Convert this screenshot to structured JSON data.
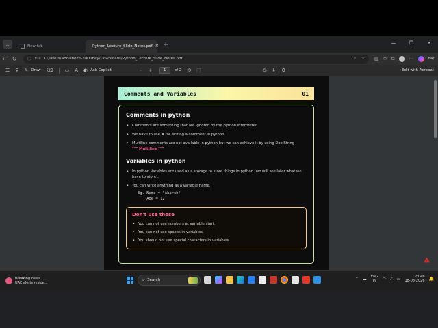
{
  "browser": {
    "tabs": [
      {
        "label": "New tab",
        "active": false
      },
      {
        "label": "Python_Lecture_Slide_Notes.pdf",
        "active": true
      }
    ],
    "address": {
      "scheme_label": "File",
      "url": "C:/Users/Abhishek%20Dubey/Downloads/Python_Lecture_Slide_Notes.pdf"
    },
    "chat_label": "Chat"
  },
  "pdf_toolbar": {
    "draw_label": "Draw",
    "ask_copilot_label": "Ask Copilot",
    "page_current": "1",
    "page_of": "of 2",
    "edit_acrobat_label": "Edit with Acrobat"
  },
  "slide": {
    "title": "Comments and Variables",
    "number": "01",
    "comments": {
      "heading": "Comments in python",
      "bullets": [
        "Comments are something that are ignored by the python interpreter.",
        "We have to use # for writing a comment in python."
      ],
      "multiline_text": "Multiline comments are not available in python but we can achieve it by using Doc String",
      "multiline_example": "\"\"\" Multiline \"\"\""
    },
    "variables": {
      "heading": "Variables in python",
      "bullets": [
        "In python Variables are used as a storage to store things in python (we will see later what we have to store).",
        "You can write anything as a variable name."
      ],
      "code_line1": "Eg. Name = \"Akarsh\"",
      "code_line2": "    Age = 12"
    },
    "dont_use": {
      "heading": "Don't use these",
      "bullets": [
        "You can not use numbers at variable start.",
        "You can not use spaces in variables.",
        "You should not use special characters in variables."
      ]
    }
  },
  "taskbar": {
    "weather_title": "Breaking news",
    "weather_sub": "UAE alerts reside...",
    "search_label": "Search",
    "lang_top": "ENG",
    "lang_bottom": "IN",
    "time": "23:46",
    "date": "18-08-2026"
  },
  "colors": {
    "accent_pink": "#ff5b86",
    "pdf_red": "#e0372c",
    "border_green": "#c9e8a8",
    "border_orange": "#f1c98b"
  }
}
